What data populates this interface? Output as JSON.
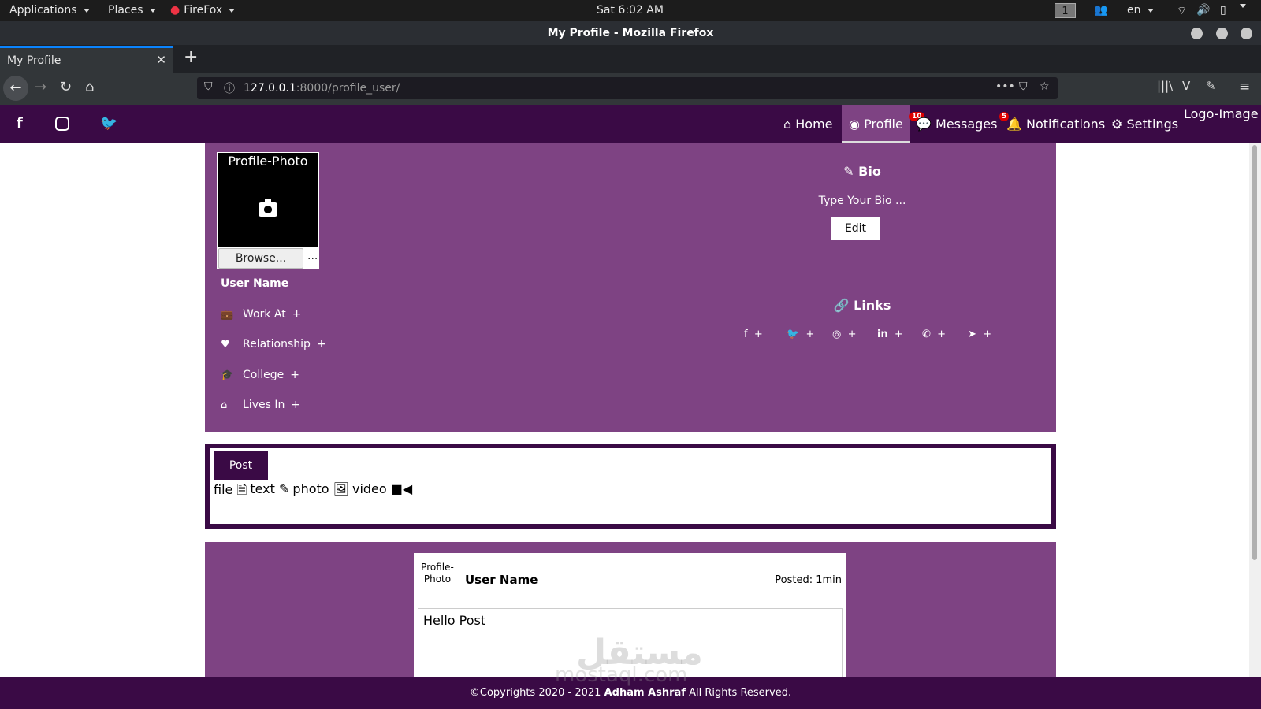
{
  "system_bar": {
    "applications": "Applications",
    "places": "Places",
    "firefox": "FireFox",
    "clock": "Sat  6:02 AM",
    "workspace": "1",
    "language": "en"
  },
  "window": {
    "title": "My Profile - Mozilla Firefox"
  },
  "tab": {
    "label": "My Profile"
  },
  "address_bar": {
    "host": "127.0.0.1",
    "rest": ":8000/profile_user/"
  },
  "site_nav": {
    "logo": "Logo-Image",
    "items": [
      {
        "label": "Home",
        "icon": "home-icon"
      },
      {
        "label": "Profile",
        "icon": "user-circle-icon"
      },
      {
        "label": "Messages",
        "icon": "comments-icon",
        "badge": "10"
      },
      {
        "label": "Notifications",
        "icon": "bell-icon",
        "badge": "5"
      },
      {
        "label": "Settings",
        "icon": "gear-icon"
      }
    ]
  },
  "profile": {
    "photo_label": "Profile-Photo",
    "browse_label": "Browse...",
    "browse_more": "...",
    "user_name": "User Name",
    "info": [
      {
        "label": "Work At",
        "icon": "briefcase-icon",
        "add": "+"
      },
      {
        "label": "Relationship",
        "icon": "heart-icon",
        "add": "+"
      },
      {
        "label": "College",
        "icon": "graduation-cap-icon",
        "add": "+"
      },
      {
        "label": "Lives In",
        "icon": "home-icon",
        "add": "+"
      }
    ],
    "bio_title": "Bio",
    "bio_placeholder": "Type Your Bio ...",
    "edit_label": "Edit",
    "links_title": "Links",
    "links": [
      {
        "icon": "facebook-icon",
        "add": "+"
      },
      {
        "icon": "twitter-icon",
        "add": "+"
      },
      {
        "icon": "instagram-icon",
        "add": "+"
      },
      {
        "icon": "linkedin-icon",
        "add": "+"
      },
      {
        "icon": "whatsapp-icon",
        "add": "+"
      },
      {
        "icon": "telegram-icon",
        "add": "+"
      }
    ]
  },
  "post_box": {
    "post_label": "Post",
    "types": [
      "file",
      "text",
      "photo",
      "video"
    ]
  },
  "feed": {
    "post": {
      "photo_label": "Profile-Photo",
      "user_name": "User Name",
      "posted": "Posted: 1min",
      "body": "Hello Post"
    }
  },
  "footer": {
    "prefix": "©Copyrights 2020 - 2021 ",
    "author": "Adham Ashraf",
    "suffix": " All Rights Reserved."
  },
  "watermark": {
    "arabic": "مستقل",
    "latin": "mostaql.com"
  },
  "colors": {
    "nav": "#3a0a45",
    "panel": "#7e4383"
  }
}
